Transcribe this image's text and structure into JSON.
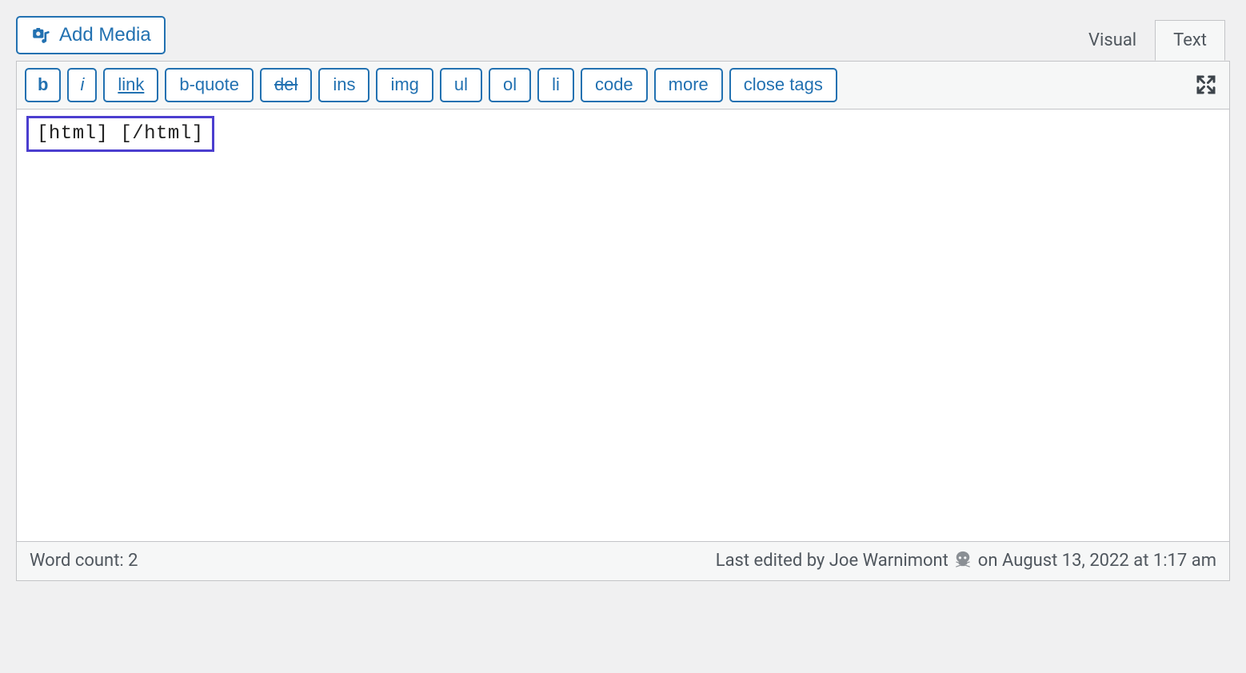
{
  "toolbar": {
    "add_media_label": "Add Media"
  },
  "tabs": {
    "visual": "Visual",
    "text": "Text"
  },
  "quicktags": {
    "bold": "b",
    "italic": "i",
    "link": "link",
    "bquote": "b-quote",
    "del": "del",
    "ins": "ins",
    "img": "img",
    "ul": "ul",
    "ol": "ol",
    "li": "li",
    "code": "code",
    "more": "more",
    "close": "close tags"
  },
  "content": {
    "snippet": "[html] [/html]"
  },
  "status": {
    "word_count_label": "Word count: 2",
    "last_edited_prefix": "Last edited by Joe Warnimont ",
    "last_edited_suffix": " on August 13, 2022 at 1:17 am"
  }
}
